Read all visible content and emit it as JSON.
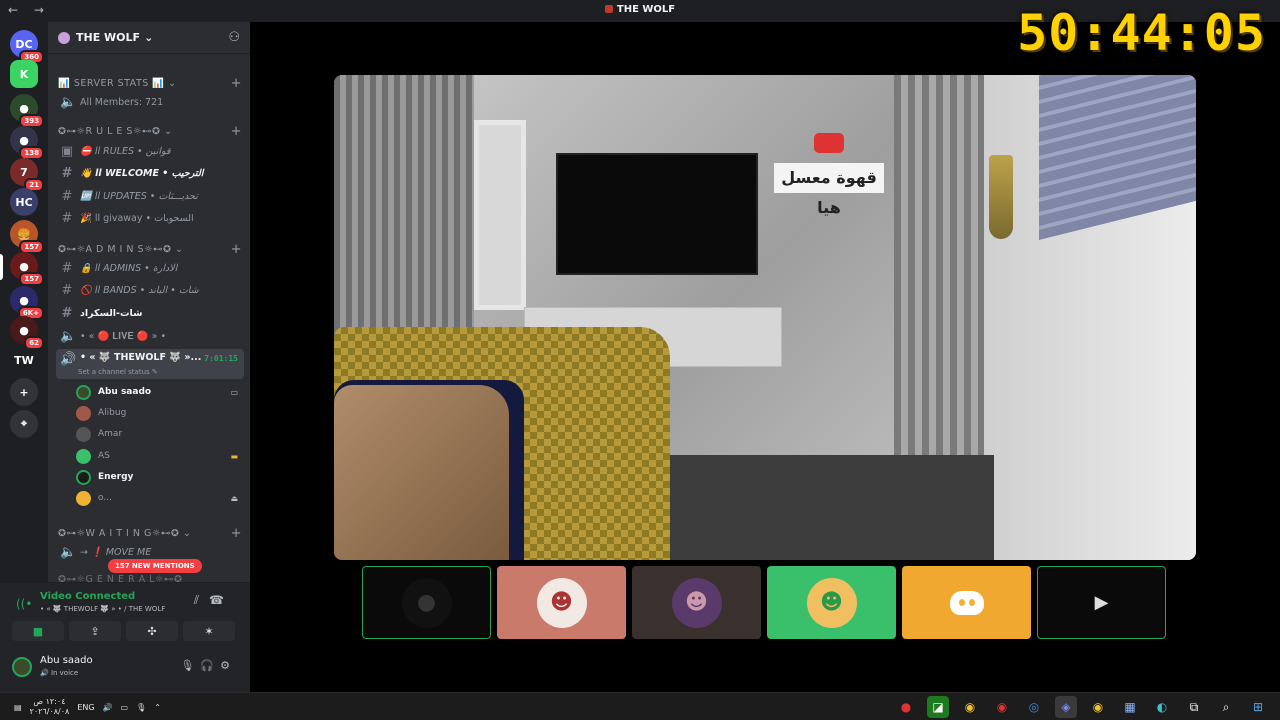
{
  "window": {
    "title": "THE WOLF",
    "nav": "← →"
  },
  "overlay_timer": "50:44:05",
  "rail": {
    "items": [
      {
        "label": "DC",
        "badge": "360",
        "bg": "#5865f2"
      },
      {
        "label": "K",
        "badge": "",
        "bg": "#3ad364"
      },
      {
        "label": "●",
        "badge": "393",
        "bg": "#2c4a2c"
      },
      {
        "label": "●",
        "badge": "138",
        "bg": "#33334a"
      },
      {
        "label": "7",
        "badge": "21",
        "bg": "#7a2a2a"
      },
      {
        "label": "HC",
        "badge": "",
        "bg": "#3a3f6a"
      },
      {
        "label": "🍔",
        "badge": "157",
        "bg": "#b8562a"
      },
      {
        "label": "●",
        "badge": "157",
        "bg": "#6a1a1a"
      },
      {
        "label": "●",
        "badge": "6K+",
        "bg": "#2a2a6a"
      },
      {
        "label": "●",
        "badge": "62",
        "bg": "#4a1a1a"
      },
      {
        "label": "TW",
        "badge": "",
        "bg": "#313338"
      },
      {
        "label": "+",
        "badge": "",
        "bg": "#313338"
      },
      {
        "label": "⌖",
        "badge": "",
        "bg": "#313338"
      }
    ]
  },
  "sidebar": {
    "server_name": "THE WOLF",
    "categories": {
      "stats": "📊 SERVER STATS 📊",
      "rules": "✪⊶☼R U L E S☼⊷✪",
      "admins": "✪⊶☼A D M I N S☼⊷✪",
      "waiting": "✪⊶☼W A I T I N G☼⊷✪",
      "general": "✪⊶☼G E N E R A L☼⊷✪"
    },
    "channels": {
      "members": "All Members: 721",
      "rules": "⛔ ll RULES • قوانين",
      "welcome": "👋 ll WELCOME • الترحيب",
      "updates": "🆙 ll UPDATES • تحديـــثات",
      "giveaway": "🎉 ll givaway • السحوبات",
      "admins": "🔒 ll ADMINS • الادارة",
      "bands": "🚫 ll BANDS • شات • الباند",
      "chat": "شات-السكراد",
      "live": "• « 🔴 𝐋𝐈𝐕𝐄 🔴 » •",
      "voice": "• « 🐺 THEWOLF 🐺 »...",
      "voice_time": "7:01:15",
      "set_status": "Set a channel status ✎",
      "move_me": "→ ❗ MOVE ME"
    },
    "voice_users": [
      {
        "name": "Abu saado",
        "on": true,
        "right": "▭",
        "color": "#3a4a2a"
      },
      {
        "name": "Alibug",
        "on": false,
        "right": "",
        "color": "#a0584a"
      },
      {
        "name": "Amar",
        "on": false,
        "right": "",
        "color": "#555"
      },
      {
        "name": "AS",
        "on": false,
        "right": "▬",
        "color": "#3ac06a"
      },
      {
        "name": "Energy",
        "on": true,
        "right": "",
        "color": "#1a1a1a"
      },
      {
        "name": "o...",
        "on": false,
        "right": "⏏",
        "color": "#f0b232"
      }
    ],
    "new_mentions": "157 NEW MENTIONS"
  },
  "voice_panel": {
    "status": "Video Connected",
    "channel": "• « 🐺 THEWOLF 🐺 » • / THE WOLF",
    "username": "Abu saado",
    "user_status": "🔊 In voice"
  },
  "video": {
    "sign_text": "قهوة معسل هيا"
  },
  "taskbar": {
    "time": "١٢:٠٤ ص",
    "date": "٢٠٢٦/٠٨/٠٨",
    "lang": "ENG"
  }
}
